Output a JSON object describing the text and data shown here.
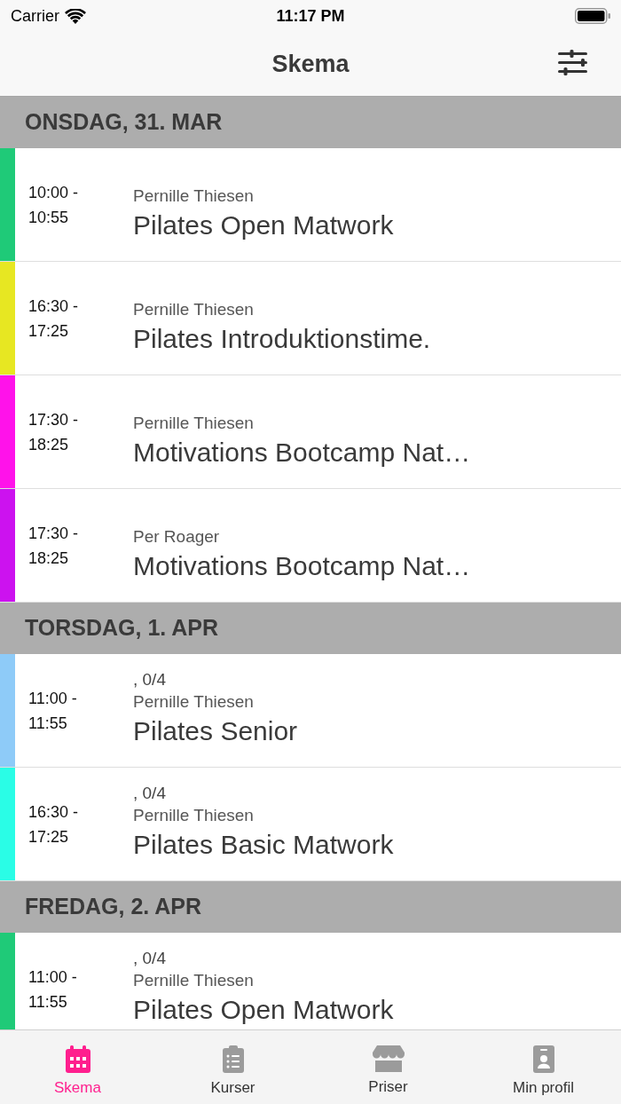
{
  "status_bar": {
    "carrier": "Carrier",
    "time": "11:17 PM"
  },
  "nav_bar": {
    "title": "Skema"
  },
  "sections": [
    {
      "date": "ONSDAG, 31. MAR",
      "classes": [
        {
          "color": "#1fca78",
          "time": "10:00 - 10:55",
          "instructor": "Pernille Thiesen",
          "title": "Pilates Open Matwork"
        },
        {
          "color": "#e7e722",
          "time": "16:30 - 17:25",
          "instructor": "Pernille Thiesen",
          "title": "Pilates Introduktionstime."
        },
        {
          "color": "#ff12ea",
          "time": "17:30 - 18:25",
          "instructor": "Pernille Thiesen",
          "title": "Motivations Bootcamp Nat…"
        },
        {
          "color": "#cc12ef",
          "time": "17:30 - 18:25",
          "instructor": "Per Roager",
          "title": "Motivations Bootcamp Nat…"
        }
      ]
    },
    {
      "date": "TORSDAG, 1. APR",
      "classes": [
        {
          "color": "#8ecbf8",
          "time": "11:00 - 11:55",
          "capacity": ", 0/4",
          "instructor": "Pernille Thiesen",
          "title": "Pilates Senior"
        },
        {
          "color": "#2afde6",
          "time": "16:30 - 17:25",
          "capacity": ", 0/4",
          "instructor": "Pernille Thiesen",
          "title": "Pilates Basic Matwork"
        }
      ]
    },
    {
      "date": "FREDAG, 2. APR",
      "classes": [
        {
          "color": "#1fca78",
          "time": "11:00 - 11:55",
          "capacity": ", 0/4",
          "instructor": "Pernille Thiesen",
          "title": "Pilates Open Matwork"
        }
      ]
    }
  ],
  "tab_bar": {
    "tabs": [
      {
        "label": "Skema",
        "selected": true
      },
      {
        "label": "Kurser",
        "selected": false
      },
      {
        "label": "Priser",
        "selected": false
      },
      {
        "label": "Min profil",
        "selected": false
      }
    ]
  }
}
